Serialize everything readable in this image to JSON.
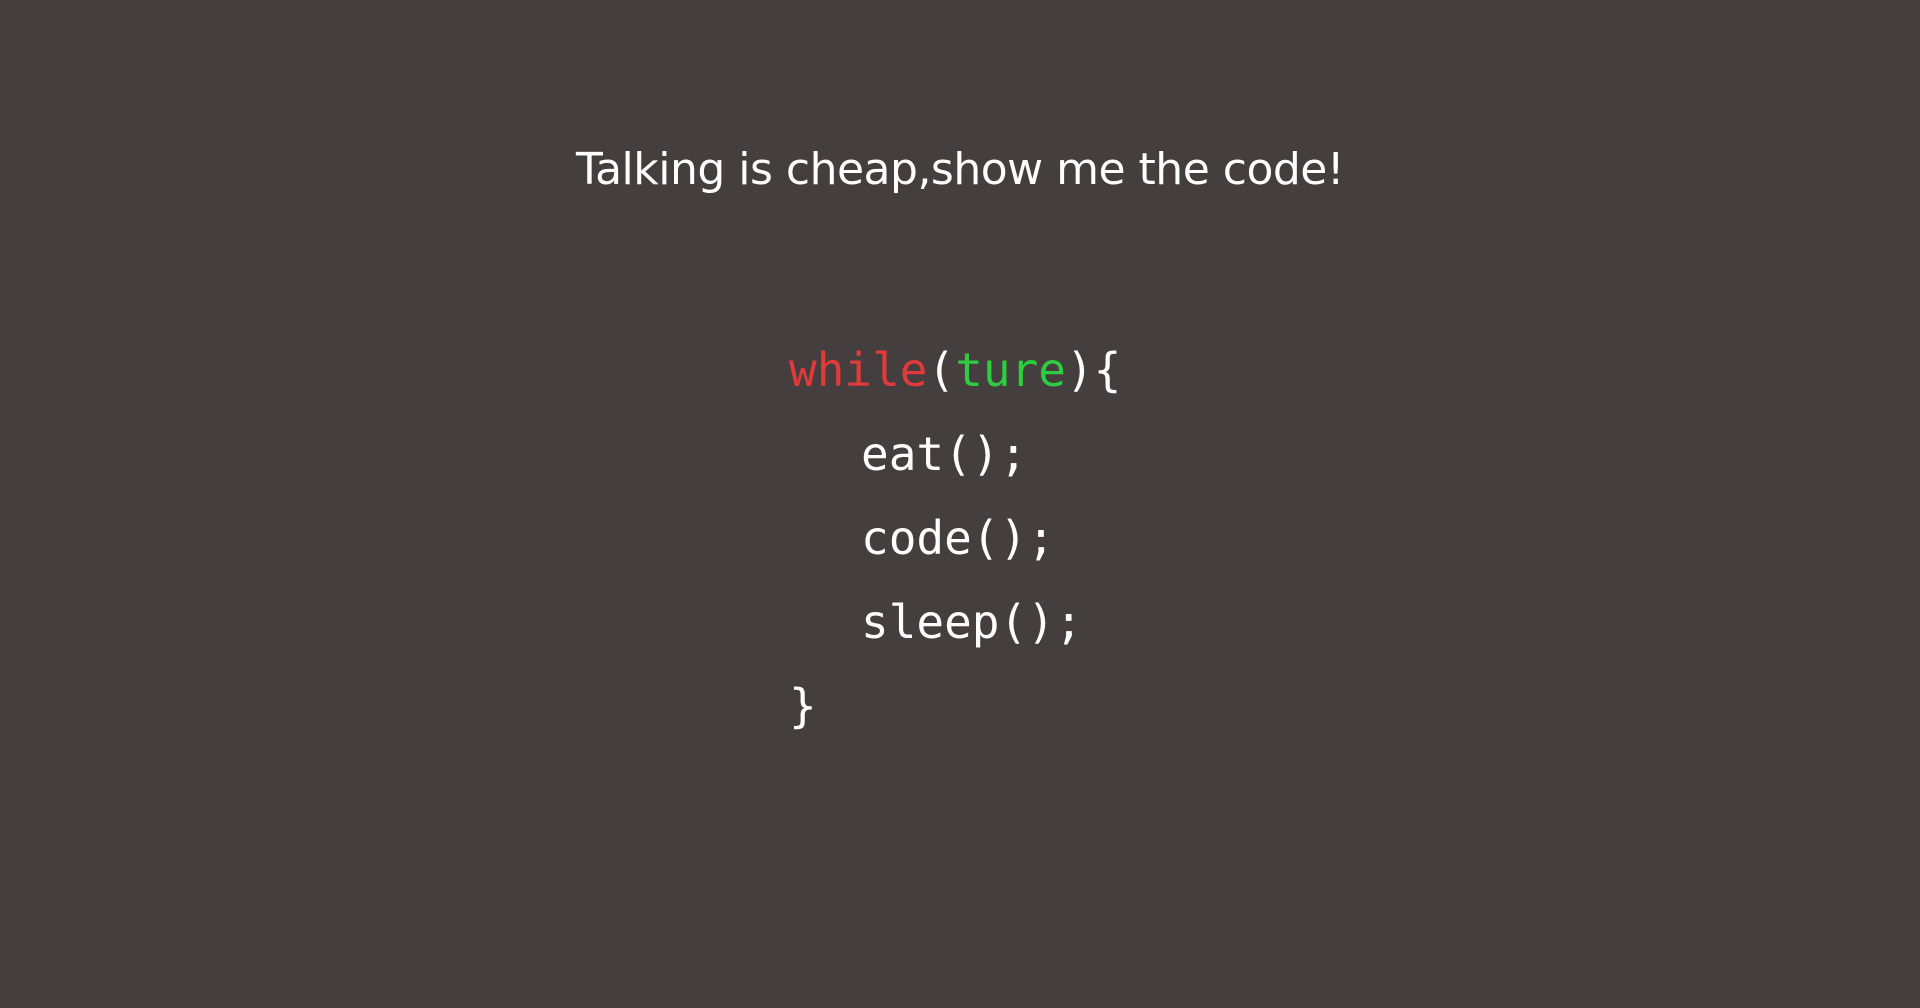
{
  "headline": "Talking is cheap,show me the code!",
  "code": {
    "keyword": "while",
    "paren_open": "(",
    "condition": "ture",
    "paren_close_brace": "){",
    "body": [
      "eat();",
      "code();",
      "sleep();"
    ],
    "closing_brace": "}"
  },
  "colors": {
    "background": "#443e3e",
    "text": "#ffffff",
    "keyword": "#e03a3a",
    "literal": "#2ecc40"
  }
}
